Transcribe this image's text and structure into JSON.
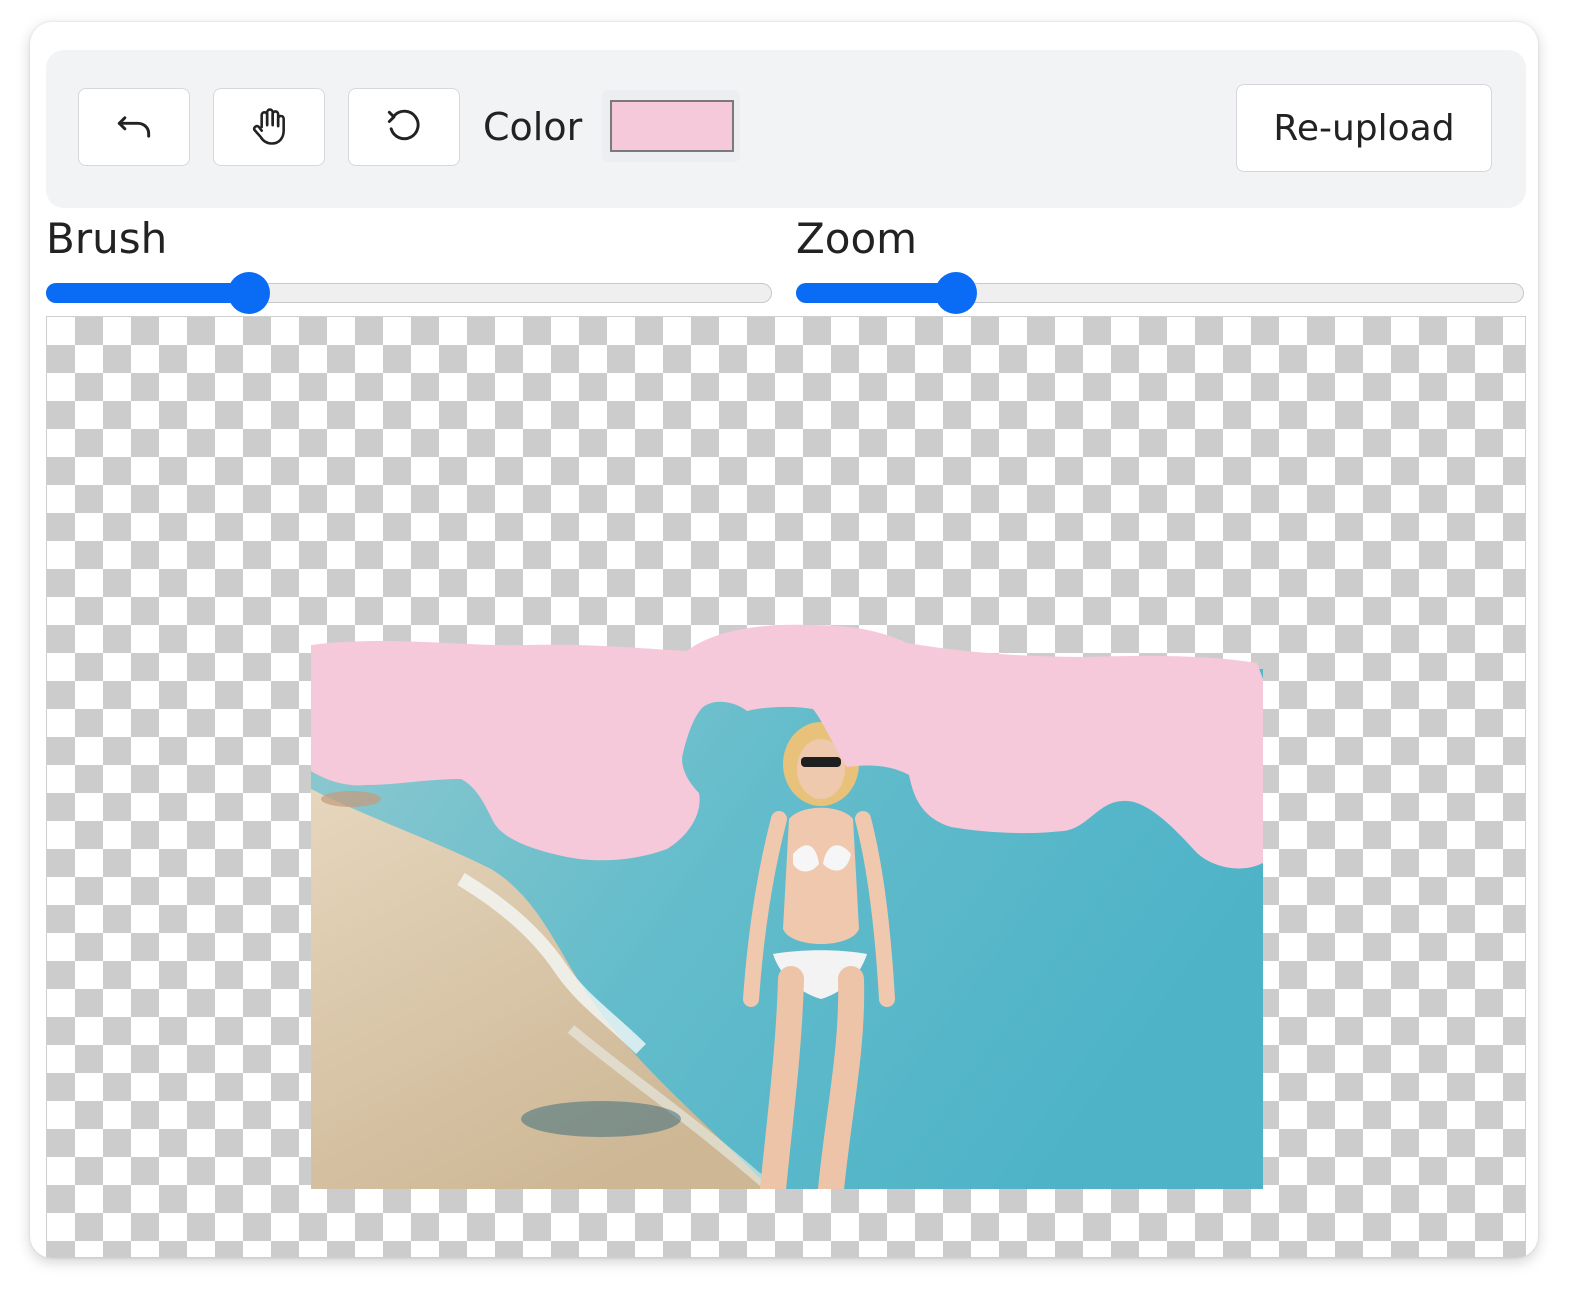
{
  "toolbar": {
    "undo_icon": "undo-icon",
    "pan_icon": "hand-icon",
    "reset_icon": "reset-icon",
    "color_label": "Color",
    "color_value": "#f5c9da",
    "reupload_label": "Re-upload"
  },
  "brush": {
    "label": "Brush",
    "value": 0.28
  },
  "zoom": {
    "label": "Zoom",
    "value": 0.22
  },
  "canvas": {
    "background": "transparency-checkerboard",
    "mask_color": "#f5c9da",
    "image": "beach-photo"
  },
  "colors": {
    "accent": "#0a6cf5"
  }
}
